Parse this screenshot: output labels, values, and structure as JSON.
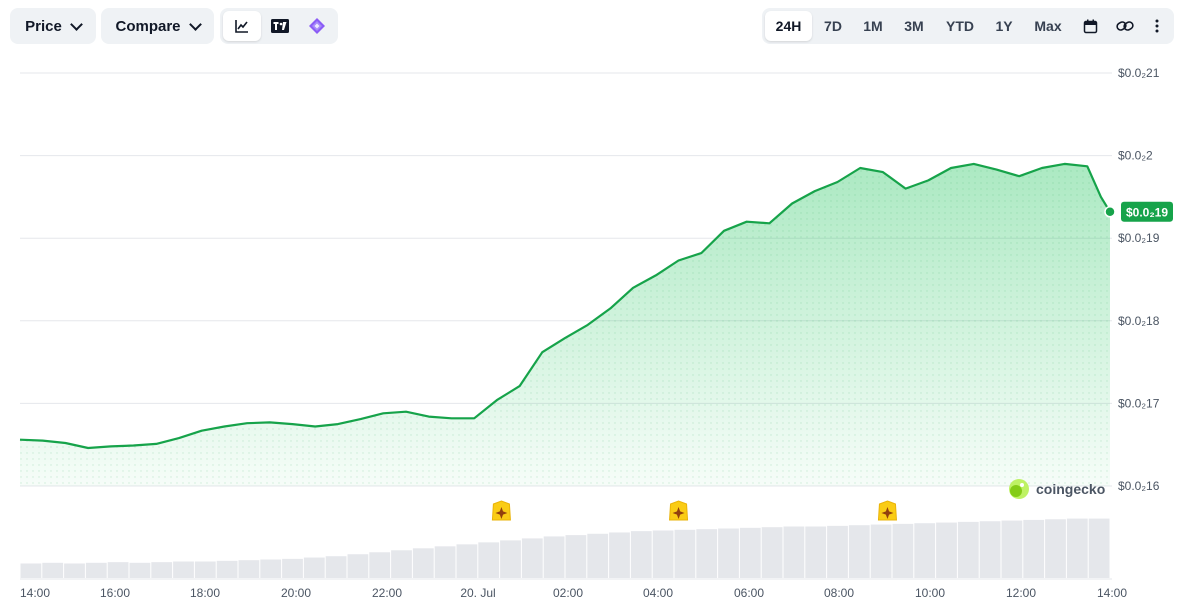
{
  "toolbar": {
    "price_label": "Price",
    "compare_label": "Compare",
    "chart_icons": [
      "line-chart-icon",
      "tradingview-icon",
      "diamond-icon"
    ],
    "ranges": [
      "24H",
      "7D",
      "1M",
      "3M",
      "YTD",
      "1Y",
      "Max"
    ],
    "active_range": "24H",
    "extra_icons": [
      "calendar-icon",
      "link-icon",
      "more-icon"
    ]
  },
  "watermark": "coingecko",
  "colors": {
    "line": "#16a34a",
    "fill": "#22c55e",
    "volume": "#e5e7eb",
    "badge": "#16a34a",
    "event": "#facc15"
  },
  "chart_data": {
    "type": "area",
    "title": "",
    "xlabel": "",
    "ylabel": "",
    "x_tick_labels": [
      "14:00",
      "16:00",
      "18:00",
      "20:00",
      "22:00",
      "20. Jul",
      "02:00",
      "04:00",
      "06:00",
      "08:00",
      "10:00",
      "12:00",
      "14:00"
    ],
    "y_tick_labels": [
      "$0.0₂21",
      "$0.0₂2",
      "$0.0₂19",
      "$0.0₂18",
      "$0.0₂17",
      "$0.0₂16"
    ],
    "y_ticks": [
      0.0021,
      0.002,
      0.0019,
      0.0018,
      0.0017,
      0.0016
    ],
    "ylim": [
      0.0016,
      0.0021
    ],
    "xlim_hours": [
      0,
      24
    ],
    "current_price_label": "$0.0₂19",
    "current_price": 0.001932,
    "price_series": [
      [
        0.0,
        0.001656
      ],
      [
        0.5,
        0.001655
      ],
      [
        1.0,
        0.001652
      ],
      [
        1.5,
        0.001646
      ],
      [
        2.0,
        0.001648
      ],
      [
        2.5,
        0.001649
      ],
      [
        3.0,
        0.001651
      ],
      [
        3.5,
        0.001658
      ],
      [
        4.0,
        0.001667
      ],
      [
        4.5,
        0.001672
      ],
      [
        5.0,
        0.001676
      ],
      [
        5.5,
        0.001677
      ],
      [
        6.0,
        0.001675
      ],
      [
        6.5,
        0.001672
      ],
      [
        7.0,
        0.001675
      ],
      [
        7.5,
        0.001681
      ],
      [
        8.0,
        0.001688
      ],
      [
        8.5,
        0.00169
      ],
      [
        9.0,
        0.001684
      ],
      [
        9.5,
        0.001682
      ],
      [
        10.0,
        0.001682
      ],
      [
        10.5,
        0.001704
      ],
      [
        11.0,
        0.001721
      ],
      [
        11.5,
        0.001762
      ],
      [
        12.0,
        0.001779
      ],
      [
        12.5,
        0.001795
      ],
      [
        13.0,
        0.001815
      ],
      [
        13.5,
        0.00184
      ],
      [
        14.0,
        0.001855
      ],
      [
        14.5,
        0.001873
      ],
      [
        15.0,
        0.001882
      ],
      [
        15.5,
        0.001909
      ],
      [
        16.0,
        0.00192
      ],
      [
        16.5,
        0.001918
      ],
      [
        17.0,
        0.001942
      ],
      [
        17.5,
        0.001957
      ],
      [
        18.0,
        0.001968
      ],
      [
        18.5,
        0.001985
      ],
      [
        19.0,
        0.00198
      ],
      [
        19.5,
        0.00196
      ],
      [
        20.0,
        0.00197
      ],
      [
        20.5,
        0.001985
      ],
      [
        21.0,
        0.00199
      ],
      [
        21.5,
        0.001983
      ],
      [
        22.0,
        0.001975
      ],
      [
        22.5,
        0.001985
      ],
      [
        23.0,
        0.00199
      ],
      [
        23.5,
        0.001987
      ],
      [
        23.8,
        0.00195
      ],
      [
        24.0,
        0.001932
      ]
    ],
    "event_markers_hours": [
      10.6,
      14.5,
      19.1
    ],
    "volume_series": [
      0.22,
      0.23,
      0.22,
      0.23,
      0.24,
      0.23,
      0.24,
      0.25,
      0.25,
      0.26,
      0.27,
      0.28,
      0.29,
      0.31,
      0.33,
      0.36,
      0.39,
      0.42,
      0.45,
      0.48,
      0.51,
      0.54,
      0.57,
      0.6,
      0.63,
      0.65,
      0.67,
      0.69,
      0.71,
      0.72,
      0.73,
      0.74,
      0.75,
      0.76,
      0.77,
      0.78,
      0.78,
      0.79,
      0.8,
      0.81,
      0.82,
      0.83,
      0.84,
      0.85,
      0.86,
      0.87,
      0.88,
      0.89,
      0.9,
      0.9
    ],
    "grid": true,
    "legend": "none"
  }
}
